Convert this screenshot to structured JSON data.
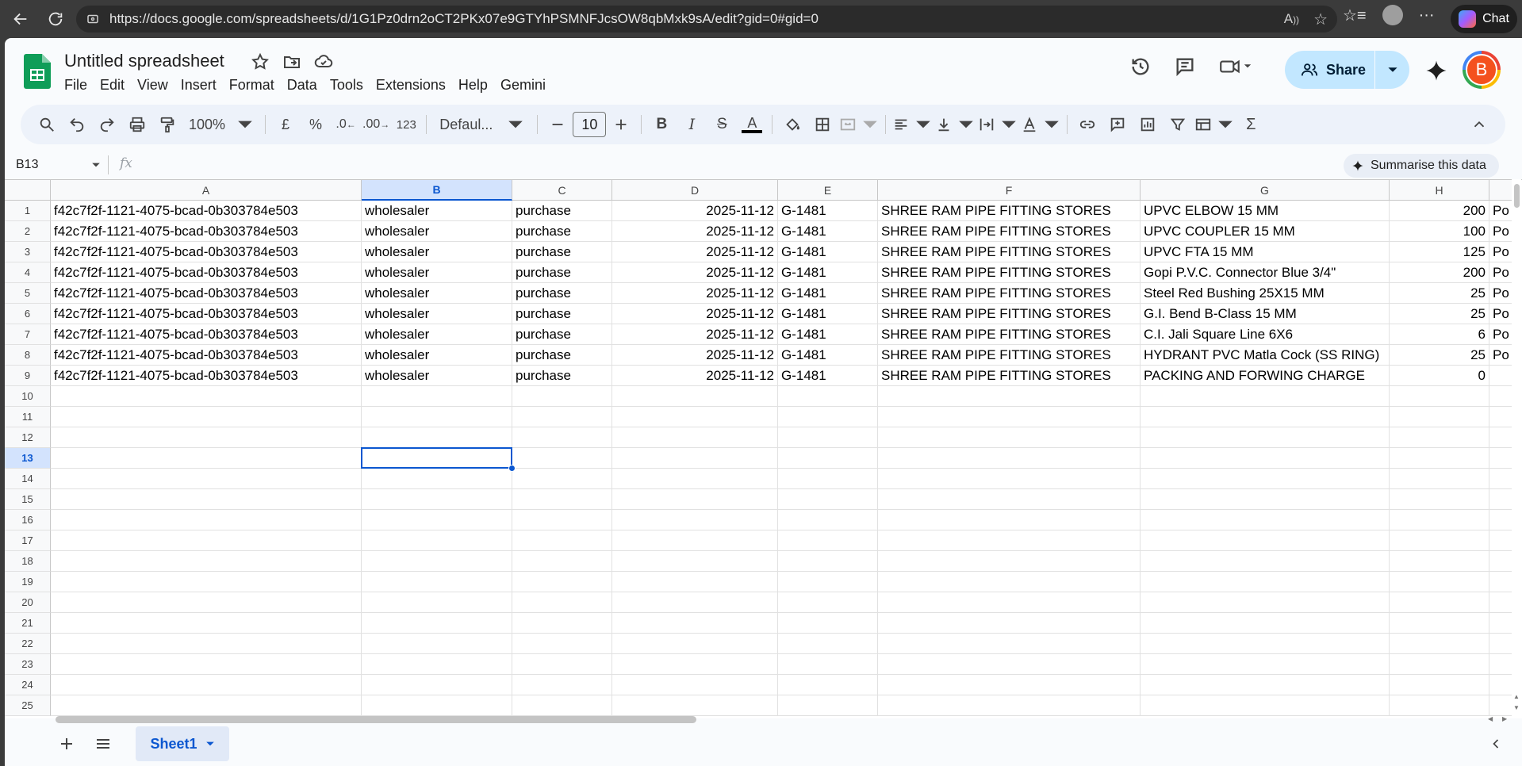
{
  "browser": {
    "url": "https://docs.google.com/spreadsheets/d/1G1Pz0drn2oCT2PKx07e9GTYhPSMNFJcsOW8qbMxk9sA/edit?gid=0#gid=0",
    "chat_label": "Chat"
  },
  "doc": {
    "title": "Untitled spreadsheet",
    "menus": [
      "File",
      "Edit",
      "View",
      "Insert",
      "Format",
      "Data",
      "Tools",
      "Extensions",
      "Help",
      "Gemini"
    ],
    "share_label": "Share",
    "avatar_letter": "B"
  },
  "toolbar": {
    "zoom": "100%",
    "currency": "£",
    "percent": "%",
    "dec_decrease": ".0",
    "dec_increase": ".00",
    "number_format": "123",
    "font": "Defaul...",
    "font_size": "10"
  },
  "formula_bar": {
    "cell_ref": "B13",
    "fx": "fx",
    "summarise_label": "Summarise this data"
  },
  "grid": {
    "columns": [
      "A",
      "B",
      "C",
      "D",
      "E",
      "F",
      "G",
      "H"
    ],
    "selected_column": "B",
    "selected_row": "13",
    "row_numbers": [
      "1",
      "2",
      "3",
      "4",
      "5",
      "6",
      "7",
      "8",
      "9",
      "10",
      "11",
      "12",
      "13",
      "14",
      "15",
      "16",
      "17",
      "18",
      "19",
      "20",
      "21",
      "22",
      "23",
      "24",
      "25"
    ],
    "rows": [
      [
        "f42c7f2f-1121-4075-bcad-0b303784e503",
        "wholesaler",
        "purchase",
        "2025-11-12",
        "G-1481",
        "SHREE RAM PIPE FITTING STORES",
        "UPVC ELBOW 15 MM",
        "200",
        "Po"
      ],
      [
        "f42c7f2f-1121-4075-bcad-0b303784e503",
        "wholesaler",
        "purchase",
        "2025-11-12",
        "G-1481",
        "SHREE RAM PIPE FITTING STORES",
        "UPVC COUPLER 15 MM",
        "100",
        "Po"
      ],
      [
        "f42c7f2f-1121-4075-bcad-0b303784e503",
        "wholesaler",
        "purchase",
        "2025-11-12",
        "G-1481",
        "SHREE RAM PIPE FITTING STORES",
        "UPVC FTA 15 MM",
        "125",
        "Po"
      ],
      [
        "f42c7f2f-1121-4075-bcad-0b303784e503",
        "wholesaler",
        "purchase",
        "2025-11-12",
        "G-1481",
        "SHREE RAM PIPE FITTING STORES",
        "Gopi P.V.C. Connector Blue 3/4\"",
        "200",
        "Po"
      ],
      [
        "f42c7f2f-1121-4075-bcad-0b303784e503",
        "wholesaler",
        "purchase",
        "2025-11-12",
        "G-1481",
        "SHREE RAM PIPE FITTING STORES",
        "Steel Red Bushing 25X15 MM",
        "25",
        "Po"
      ],
      [
        "f42c7f2f-1121-4075-bcad-0b303784e503",
        "wholesaler",
        "purchase",
        "2025-11-12",
        "G-1481",
        "SHREE RAM PIPE FITTING STORES",
        "G.I. Bend B-Class 15 MM",
        "25",
        "Po"
      ],
      [
        "f42c7f2f-1121-4075-bcad-0b303784e503",
        "wholesaler",
        "purchase",
        "2025-11-12",
        "G-1481",
        "SHREE RAM PIPE FITTING STORES",
        "C.I. Jali Square Line 6X6",
        "6",
        "Po"
      ],
      [
        "f42c7f2f-1121-4075-bcad-0b303784e503",
        "wholesaler",
        "purchase",
        "2025-11-12",
        "G-1481",
        "SHREE RAM PIPE FITTING STORES",
        "HYDRANT PVC Matla Cock (SS RING)",
        "25",
        "Po"
      ],
      [
        "f42c7f2f-1121-4075-bcad-0b303784e503",
        "wholesaler",
        "purchase",
        "2025-11-12",
        "G-1481",
        "SHREE RAM PIPE FITTING STORES",
        "PACKING AND FORWING CHARGE",
        "0",
        ""
      ]
    ]
  },
  "sheets": {
    "active": "Sheet1"
  },
  "colors": {
    "accent": "#0b57d0",
    "share_bg": "#c2e7ff",
    "sheets_green": "#0f9d58",
    "avatar": "#f4511e"
  }
}
